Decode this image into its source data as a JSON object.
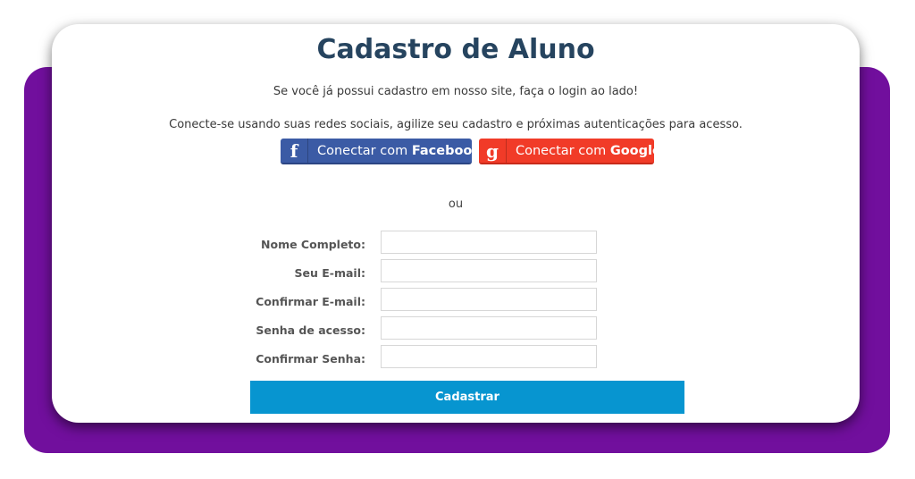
{
  "page": {
    "title": "Cadastro de Aluno",
    "login_hint": "Se você já possui cadastro em nosso site, faça o login ao lado!",
    "social_hint": "Conecte-se usando suas redes sociais, agilize seu cadastro e próximas autenticações para acesso.",
    "separator": "ou"
  },
  "social": {
    "facebook": {
      "icon": "f",
      "prefix": "Conectar com ",
      "brand": "Facebook",
      "color": "#3b5ba5"
    },
    "google": {
      "icon": "g",
      "prefix": "Conectar com ",
      "brand": "Google",
      "color": "#f13b28"
    }
  },
  "form": {
    "fields": [
      {
        "label": "Nome Completo:",
        "value": ""
      },
      {
        "label": "Seu E-mail:",
        "value": ""
      },
      {
        "label": "Confirmar E-mail:",
        "value": ""
      },
      {
        "label": "Senha de acesso:",
        "value": ""
      },
      {
        "label": "Confirmar Senha:",
        "value": ""
      }
    ],
    "submit_label": "Cadastrar"
  },
  "colors": {
    "background_accent": "#710f9d",
    "title": "#26445f",
    "submit": "#0795d0"
  }
}
